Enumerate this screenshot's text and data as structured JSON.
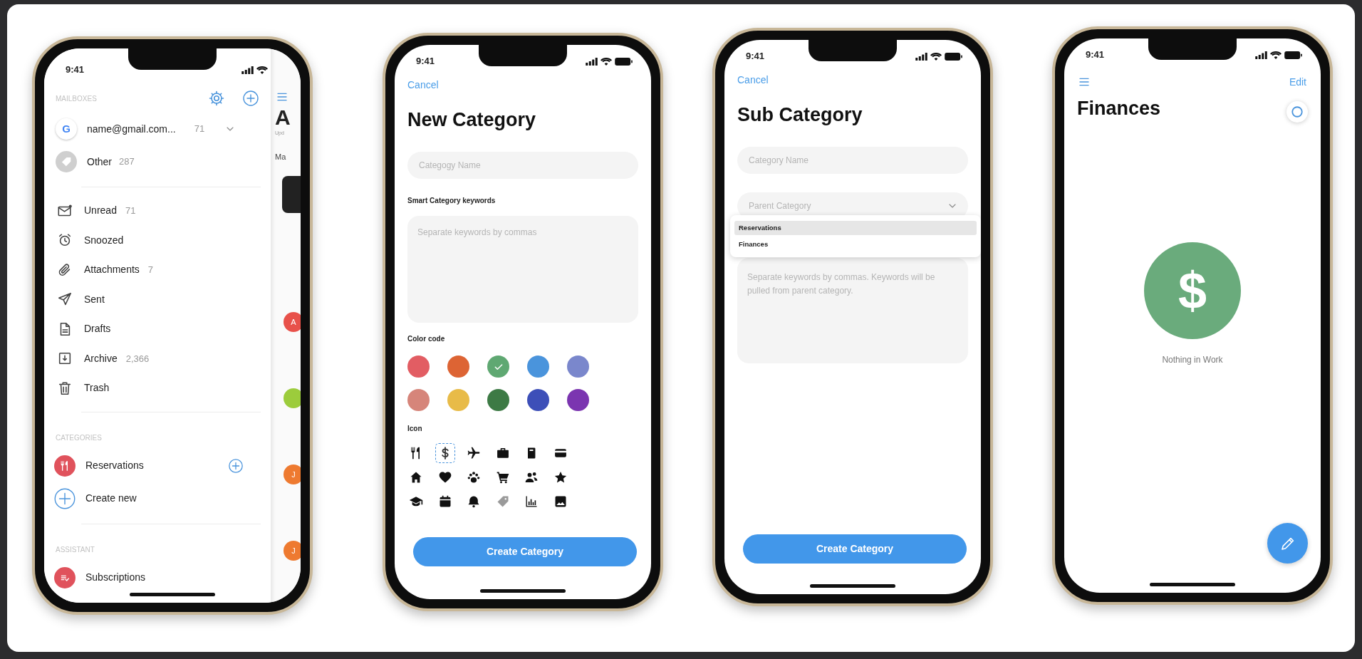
{
  "phones": [
    {
      "kind": "mailboxes",
      "status": {
        "time": "9:41",
        "battery": false
      },
      "drawer": {
        "header": "MAILBOXES",
        "accounts": [
          {
            "kind": "google",
            "badge": "G",
            "name": "name@gmail.com...",
            "count": "71"
          },
          {
            "kind": "other",
            "name": "Other",
            "count": "287"
          }
        ],
        "folders": [
          {
            "kind": "envelope",
            "label": "Unread",
            "count": "71"
          },
          {
            "kind": "alarm",
            "label": "Snoozed"
          },
          {
            "kind": "paperclip",
            "label": "Attachments",
            "count": "7"
          },
          {
            "kind": "send",
            "label": "Sent"
          },
          {
            "kind": "document",
            "label": "Drafts"
          },
          {
            "kind": "archive",
            "label": "Archive",
            "count": "2,366"
          },
          {
            "kind": "trash",
            "label": "Trash"
          }
        ],
        "categories_header": "CATEGORIES",
        "categories": [
          {
            "kind": "fork-knife",
            "label": "Reservations",
            "color": "#e0525c"
          }
        ],
        "create_label": "Create new",
        "assistant_header": "ASSISTANT",
        "assistant": [
          {
            "kind": "list-check",
            "label": "Subscriptions",
            "color": "#e0525c"
          }
        ]
      },
      "behind": {
        "title": "A",
        "subtitle": "Upd",
        "tab": "Ma",
        "avatars": [
          {
            "color": "#e8514a",
            "letter": "A"
          },
          {
            "color": "#9ccc3c"
          },
          {
            "color": "#ee7a30",
            "letter": "J"
          },
          {
            "color": "#ee7a30",
            "letter": "J"
          }
        ]
      }
    },
    {
      "kind": "new_category",
      "status": {
        "time": "9:41",
        "battery": true
      },
      "cancel": "Cancel",
      "title": "New Category",
      "name_field": {
        "placeholder": "Categogy Name"
      },
      "keywords_label": "Smart Category keywords",
      "keywords_field": {
        "placeholder": "Separate keywords by commas"
      },
      "color_label": "Color code",
      "colors": [
        {
          "color": "#e25d63",
          "selected": false
        },
        {
          "color": "#dd6434",
          "selected": false
        },
        {
          "color": "#5fa872",
          "selected": true
        },
        {
          "color": "#4a94dc",
          "selected": false
        },
        {
          "color": "#7a87cc",
          "selected": false
        },
        {
          "color": "#d6857a",
          "selected": false
        },
        {
          "color": "#e8bb48",
          "selected": false
        },
        {
          "color": "#3d7a45",
          "selected": false
        },
        {
          "color": "#3d4fb8",
          "selected": false
        },
        {
          "color": "#7b35b0",
          "selected": false
        }
      ],
      "icon_label": "Icon",
      "icons": [
        {
          "kind": "fork-knife",
          "selected": false,
          "disabled": false
        },
        {
          "kind": "dollar",
          "selected": true,
          "disabled": false
        },
        {
          "kind": "plane",
          "selected": false,
          "disabled": false
        },
        {
          "kind": "briefcase",
          "selected": false,
          "disabled": false
        },
        {
          "kind": "book",
          "selected": false,
          "disabled": false
        },
        {
          "kind": "card",
          "selected": false,
          "disabled": false
        },
        {
          "kind": "house",
          "selected": false,
          "disabled": false
        },
        {
          "kind": "heart",
          "selected": false,
          "disabled": false
        },
        {
          "kind": "paw",
          "selected": false,
          "disabled": false
        },
        {
          "kind": "cart",
          "selected": false,
          "disabled": false
        },
        {
          "kind": "people",
          "selected": false,
          "disabled": false
        },
        {
          "kind": "star",
          "selected": false,
          "disabled": false
        },
        {
          "kind": "cap",
          "selected": false,
          "disabled": false
        },
        {
          "kind": "calendar",
          "selected": false,
          "disabled": false
        },
        {
          "kind": "bell",
          "selected": false,
          "disabled": false
        },
        {
          "kind": "tag",
          "selected": false,
          "disabled": true
        },
        {
          "kind": "chart",
          "selected": false,
          "disabled": false
        },
        {
          "kind": "image",
          "selected": false,
          "disabled": false
        }
      ],
      "button": "Create Category"
    },
    {
      "kind": "sub_category",
      "status": {
        "time": "9:41",
        "battery": true
      },
      "cancel": "Cancel",
      "title": "Sub Category",
      "name_field": {
        "placeholder": "Category Name"
      },
      "parent_field": {
        "placeholder": "Parent Category",
        "expanded": true
      },
      "parent_options": [
        {
          "label": "Reservations",
          "selected": true
        },
        {
          "label": "Finances",
          "selected": false
        }
      ],
      "keywords_field": {
        "placeholder": "Separate keywords by commas. Keywords will be pulled from parent category."
      },
      "button": "Create Category"
    },
    {
      "kind": "category_view",
      "status": {
        "time": "9:41",
        "battery": true
      },
      "edit": "Edit",
      "title": "Finances",
      "symbol": "$",
      "empty_text": "Nothing in Work"
    }
  ]
}
